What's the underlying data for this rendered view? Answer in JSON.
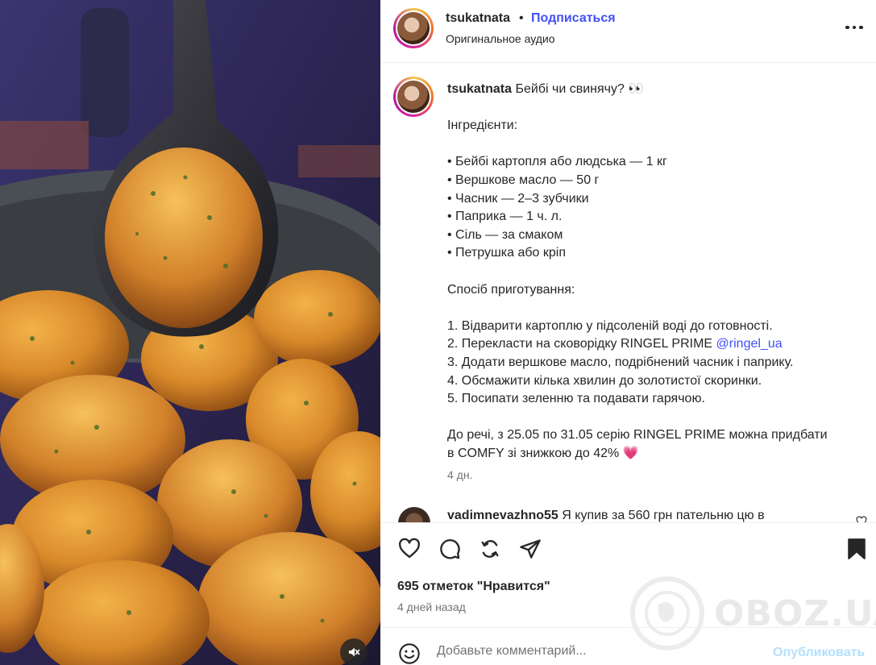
{
  "post": {
    "username": "tsukatnata",
    "separator": "•",
    "follow_label": "Подписаться",
    "audio_label": "Оригинальное аудио",
    "more_icon": "more-horizontal-icon"
  },
  "caption": {
    "username": "tsukatnata",
    "text_before_mention": " Бейбі чи свинячу? 👀\n\nІнгредієнти:\n\n• Бейбі картопля або людська — 1 кг\n• Вершкове масло — 50 г\n• Часник — 2–3 зубчики\n• Паприка — 1 ч. л.\n• Сіль — за смаком\n• Петрушка або кріп\n\nСпосіб приготування:\n\n1. Відварити картоплю у підсоленій воді до готовності.\n2. Перекласти на сковорідку RINGEL PRIME ",
    "mention": "@ringel_ua",
    "text_after_mention": "\n3. Додати вершкове масло, подрібнений часник і паприку.\n4. Обсмажити кілька хвилин до золотистої скоринки.\n5. Посипати зеленню та подавати гарячою.\n\nДо речі, з 25.05 по 31.05 серію RINGEL PRIME можна придбати\nв COMFY зі знижкою до 42% 💗",
    "time": "4 дн."
  },
  "comment": {
    "username": "vadimnevazhno55",
    "text": " Я купив за 560 грн пательню цю в"
  },
  "actions": {
    "likes": "695 отметок \"Нравится\"",
    "posted": "4 дней назад"
  },
  "comment_bar": {
    "placeholder": "Добавьте комментарий...",
    "post_label": "Опубликовать"
  },
  "watermark": {
    "text": "OBOZ.UA"
  },
  "colors": {
    "accent": "#4150f7",
    "muted": "#737373",
    "post_disabled": "#b2dffc"
  }
}
